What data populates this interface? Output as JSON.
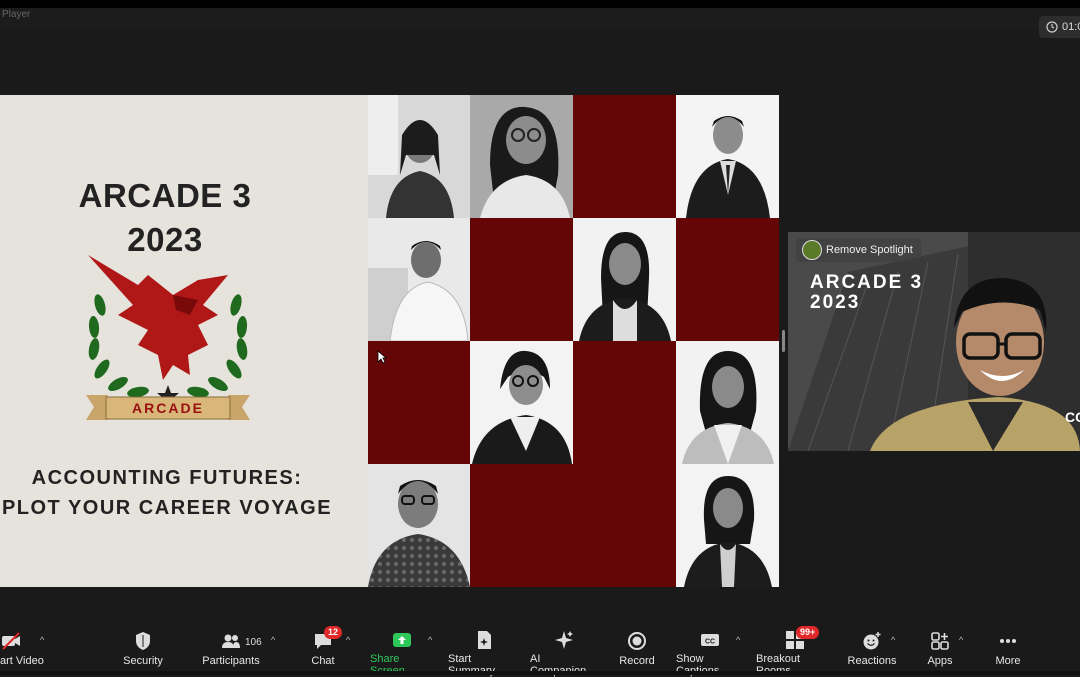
{
  "app": {
    "title": "Player",
    "timer": "01:0"
  },
  "slide": {
    "title_line1": "ARCADE 3",
    "title_line2": "2023",
    "logo_banner": "ARCADE",
    "subtitle_line1": "ACCOUNTING FUTURES:",
    "subtitle_line2": "PLOT YOUR CAREER VOYAGE"
  },
  "speaker": {
    "spotlight_label": "Remove Spotlight",
    "bg_title_line1": "ARCADE 3",
    "bg_title_line2": "2023",
    "bg_partial": "CC"
  },
  "toolbar": {
    "items": [
      {
        "label": "art Video",
        "icon": "video-off-icon"
      },
      {
        "label": "Security",
        "icon": "shield-icon"
      },
      {
        "label": "Participants",
        "icon": "participants-icon",
        "count": "106"
      },
      {
        "label": "Chat",
        "icon": "chat-icon",
        "badge": "12"
      },
      {
        "label": "Share Screen",
        "icon": "share-screen-icon"
      },
      {
        "label": "Start Summary",
        "icon": "summary-icon"
      },
      {
        "label": "AI Companion",
        "icon": "sparkle-icon"
      },
      {
        "label": "Record",
        "icon": "record-icon"
      },
      {
        "label": "Show Captions",
        "icon": "cc-icon"
      },
      {
        "label": "Breakout Rooms",
        "icon": "breakout-icon",
        "badge": "99+"
      },
      {
        "label": "Reactions",
        "icon": "reactions-icon"
      },
      {
        "label": "Apps",
        "icon": "apps-icon"
      },
      {
        "label": "More",
        "icon": "more-icon"
      }
    ]
  },
  "colors": {
    "maroon": "#650606",
    "share_green": "#2ec85a",
    "badge_red": "#e02828"
  }
}
